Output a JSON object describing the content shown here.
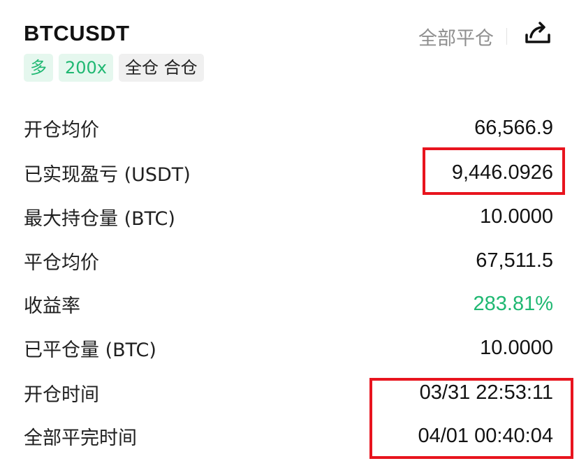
{
  "header": {
    "symbol": "BTCUSDT",
    "close_all": "全部平仓",
    "tags": [
      {
        "text": "多",
        "style": "green"
      },
      {
        "text": "200x",
        "style": "green"
      },
      {
        "text": "全仓 合仓",
        "style": "gray"
      }
    ]
  },
  "colors": {
    "profit_green": "#1fb872",
    "highlight_red": "#e8141e"
  },
  "rows": [
    {
      "label": "开仓均价",
      "value": "66,566.9"
    },
    {
      "label": "已实现盈亏 (USDT)",
      "value": "9,446.0926"
    },
    {
      "label": "最大持仓量 (BTC)",
      "value": "10.0000"
    },
    {
      "label": "平仓均价",
      "value": "67,511.5"
    },
    {
      "label": "收益率",
      "value": "283.81%"
    },
    {
      "label": "已平仓量 (BTC)",
      "value": "10.0000"
    },
    {
      "label": "开仓时间",
      "value": "03/31 22:53:11"
    },
    {
      "label": "全部平完时间",
      "value": "04/01 00:40:04"
    }
  ]
}
